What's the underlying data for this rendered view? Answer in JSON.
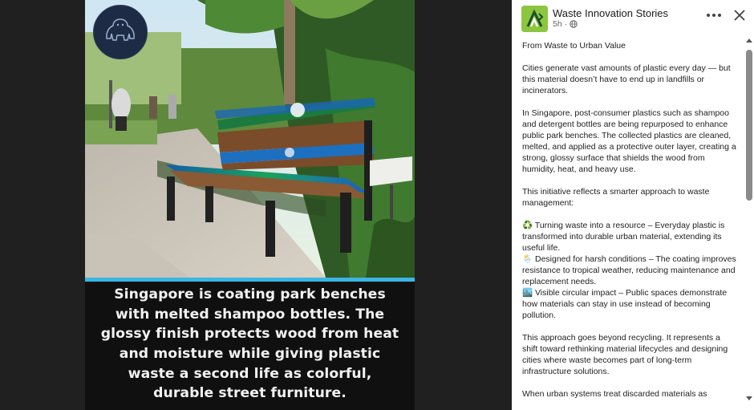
{
  "post": {
    "author": "Waste Innovation Stories",
    "time": "5h",
    "visibility_icon": "globe-icon",
    "paragraphs": [
      "From Waste to Urban Value",
      "Cities generate vast amounts of plastic every day — but this material doesn’t have to end up in landfills or incinerators.",
      "In Singapore, post-consumer plastics such as shampoo and detergent bottles are being repurposed to enhance public park benches. The collected plastics are cleaned, melted, and applied as a protective outer layer, creating a strong, glossy surface that shields the wood from humidity, heat, and heavy use.",
      "This initiative reflects a smarter approach to waste management:",
      "♻️ Turning waste into a resource – Everyday plastic is transformed into durable urban material, extending its useful life.\n🌦️ Designed for harsh conditions – The coating improves resistance to tropical weather, reducing maintenance and replacement needs.\n🏙️ Visible circular impact – Public spaces demonstrate how materials can stay in use instead of becoming pollution.",
      "This approach goes beyond recycling. It represents a shift toward rethinking material lifecycles and designing cities where waste becomes part of long-term infrastructure solutions.",
      "When urban systems treat discarded materials as"
    ]
  },
  "image": {
    "caption": "Singapore is coating park benches with melted shampoo bottles. The glossy finish protects wood from heat and moisture while giving plastic waste a second life as colorful, durable street furniture."
  },
  "colors": {
    "caption_band": "#39b6e4",
    "avatar_bg": "#8cc63f"
  }
}
